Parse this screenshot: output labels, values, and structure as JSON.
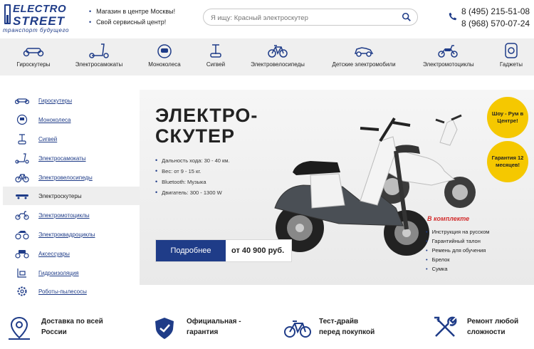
{
  "header": {
    "logo_line1": "ELECTRO",
    "logo_line2": "STREET",
    "logo_tagline": "транспорт будущего",
    "info": [
      "Магазин в центре Москвы!",
      "Свой сервисный центр!"
    ],
    "search_placeholder": "Я ищу: Красный электроскутер",
    "phones": [
      "8 (495) 215-51-08",
      "8 (968) 570-07-24"
    ]
  },
  "categories": [
    {
      "label": "Гироскутеры",
      "icon": "hoverboard-icon"
    },
    {
      "label": "Электросамокаты",
      "icon": "kick-scooter-icon"
    },
    {
      "label": "Моноколеса",
      "icon": "monowheel-icon"
    },
    {
      "label": "Сигвей",
      "icon": "segway-icon"
    },
    {
      "label": "Электровелосипеды",
      "icon": "bicycle-icon"
    },
    {
      "label": "Детские электромобили",
      "icon": "kids-car-icon"
    },
    {
      "label": "Электромотоциклы",
      "icon": "motorcycle-icon"
    },
    {
      "label": "Гаджеты",
      "icon": "gadget-icon"
    }
  ],
  "sidebar": {
    "items": [
      {
        "label": "Гироскутеры"
      },
      {
        "label": "Моноколеса"
      },
      {
        "label": "Сигвей"
      },
      {
        "label": "Электросамокаты"
      },
      {
        "label": "Электровелосипеды"
      },
      {
        "label": "Электроскутеры"
      },
      {
        "label": "Электромотоциклы"
      },
      {
        "label": "Электроквадроциклы"
      },
      {
        "label": "Аксессуары"
      },
      {
        "label": "Гидроизоляция"
      },
      {
        "label": "Роботы-пылесосы"
      }
    ],
    "active": "Электроскутеры"
  },
  "hero": {
    "title_line1": "ЭЛЕКТРО-",
    "title_line2": "СКУТЕР",
    "features": [
      "Дальность хода: 30 - 40 км.",
      "Вес: от 9 - 15 кг.",
      "Bluetooth: Музыка",
      "Двигатель: 300 - 1300 W"
    ],
    "more_button": "Подробнее",
    "price": "от 40 900 руб.",
    "badge1": "Шоу - Рум в Центре!",
    "badge2": "Гарантия 12 месяцев!",
    "kit_title": "В комплекте",
    "kit_items": [
      "Инструкция на русском",
      "Гарантийный талон",
      "Ремень для обучения",
      "Брелок",
      "Сумка"
    ]
  },
  "benefits": [
    {
      "line1": "Доставка по всей",
      "line2": "России",
      "icon": "map-pin-icon"
    },
    {
      "line1": "Официальная -",
      "line2": "гарантия",
      "icon": "shield-icon"
    },
    {
      "line1": "Тест-драйв",
      "line2": "перед покупкой",
      "icon": "bicycle-icon"
    },
    {
      "line1": "Ремонт любой",
      "line2": "сложности",
      "icon": "tools-icon"
    }
  ],
  "colors": {
    "brand_blue": "#1f3c88",
    "badge_yellow": "#f5c800",
    "kit_red": "#d32f2f",
    "strip_gray": "#efefef"
  }
}
